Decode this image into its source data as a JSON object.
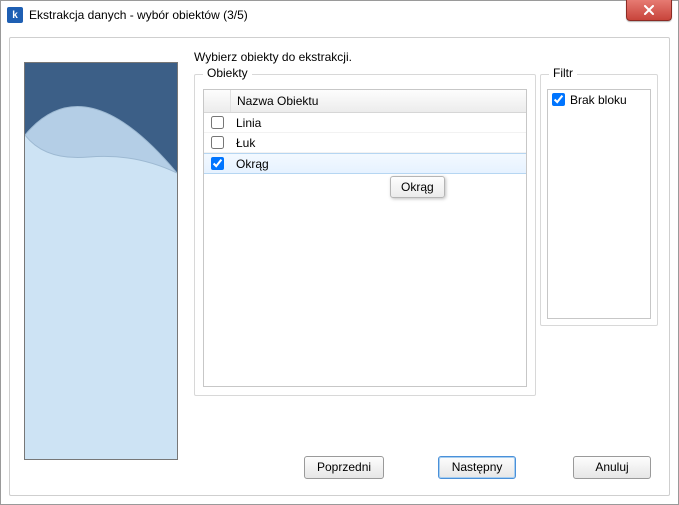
{
  "window": {
    "title": "Ekstrakcja danych - wybór obiektów (3/5)",
    "app_icon_letter": "k"
  },
  "instruction": "Wybierz obiekty do ekstrakcji.",
  "objects": {
    "legend": "Obiekty",
    "header": "Nazwa Obiektu",
    "rows": [
      {
        "label": "Linia",
        "checked": false,
        "selected": false
      },
      {
        "label": "Łuk",
        "checked": false,
        "selected": false
      },
      {
        "label": "Okrąg",
        "checked": true,
        "selected": true
      }
    ],
    "tooltip": "Okrąg"
  },
  "filter": {
    "legend": "Filtr",
    "rows": [
      {
        "label": "Brak bloku",
        "checked": true
      }
    ]
  },
  "buttons": {
    "prev": "Poprzedni",
    "next": "Następny",
    "cancel": "Anuluj"
  },
  "preview": {
    "fill": "#3c5f87",
    "paper": "#cde3f4"
  }
}
